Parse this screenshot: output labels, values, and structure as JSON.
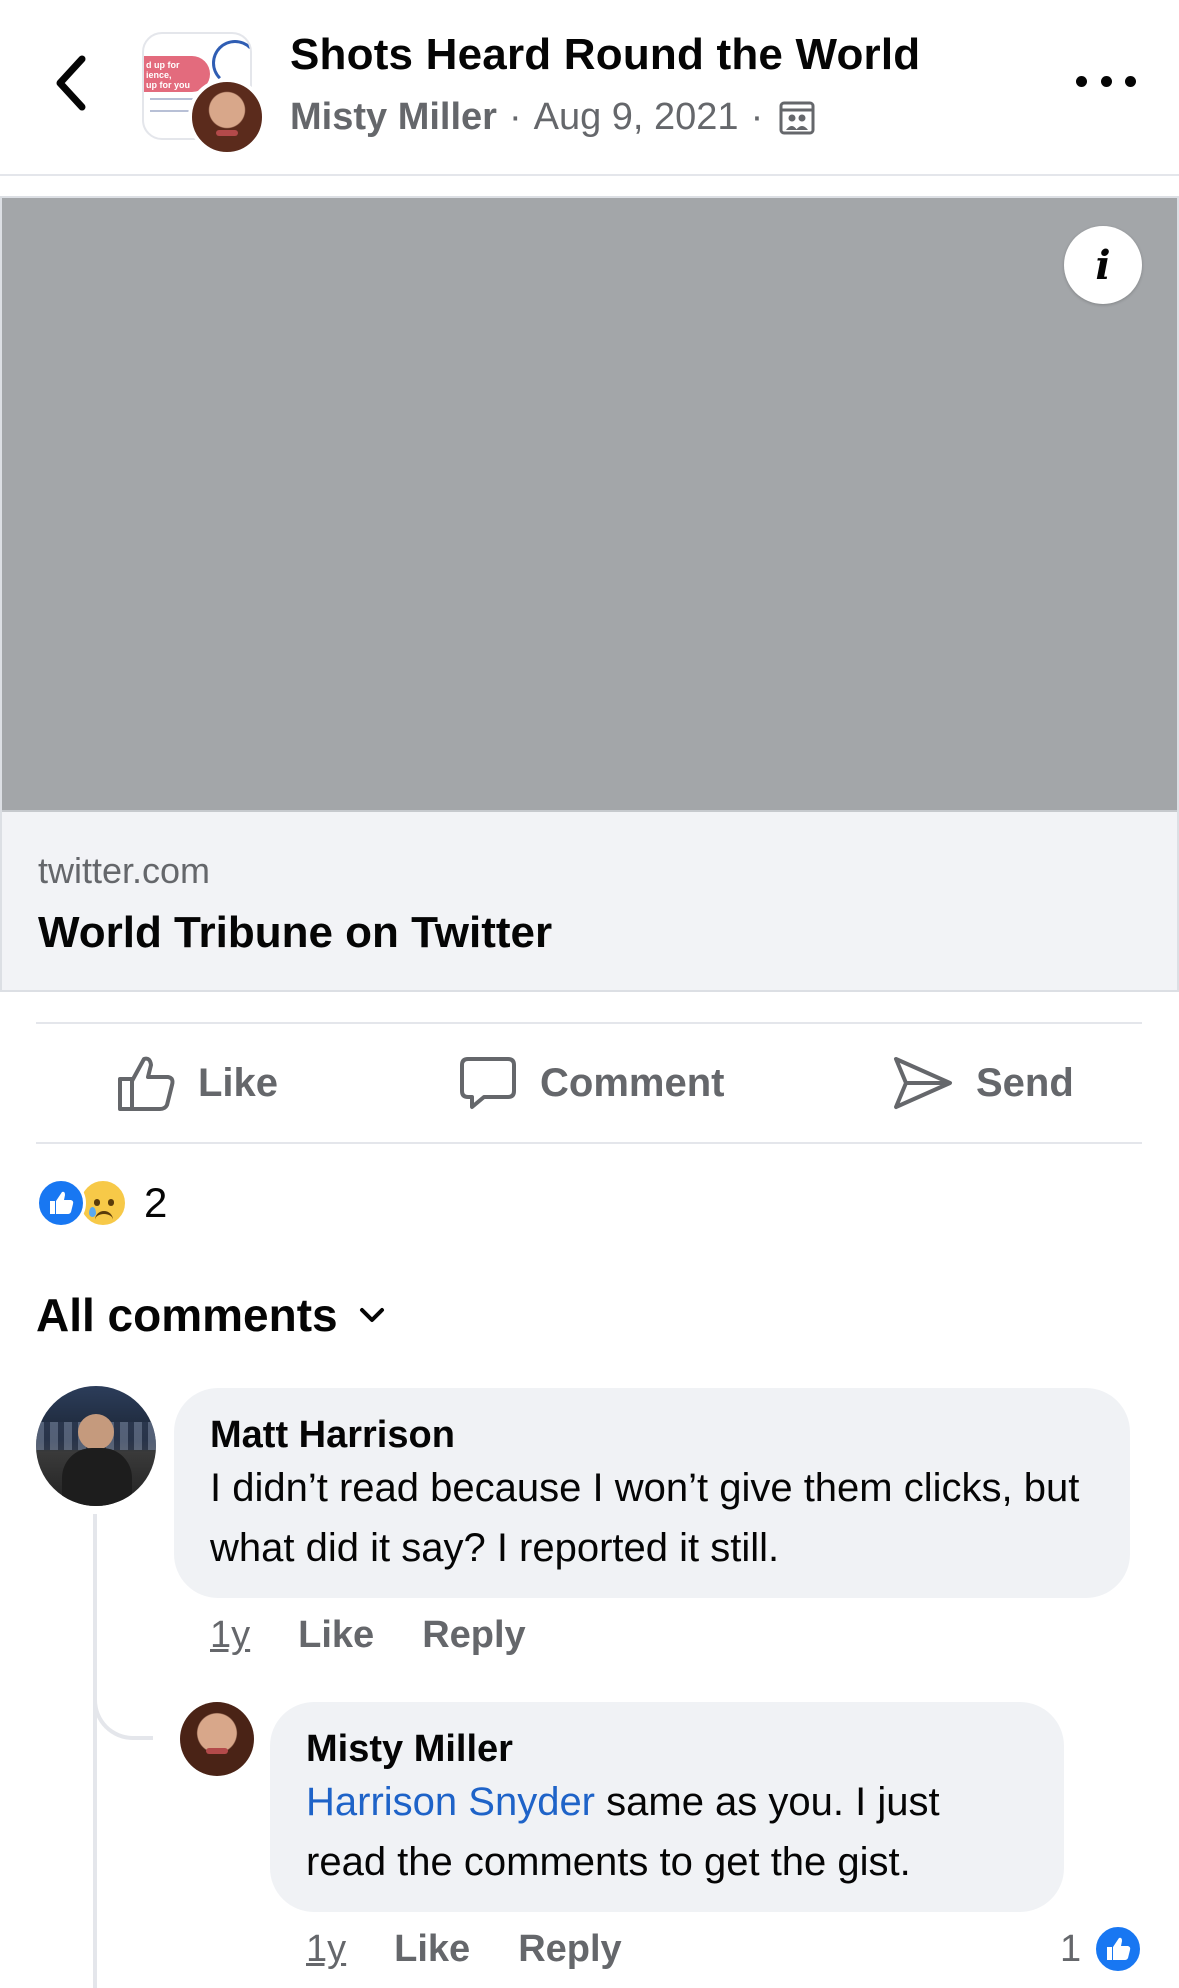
{
  "header": {
    "title": "Shots Heard Round the World",
    "author": "Misty Miller",
    "separator": "·",
    "date": "Aug 9, 2021",
    "thumb_text": "d up for\nience,\nup for you"
  },
  "post": {
    "link_domain": "twitter.com",
    "link_title": "World Tribune on Twitter",
    "info_label": "i"
  },
  "actions": {
    "like": "Like",
    "comment": "Comment",
    "send": "Send"
  },
  "reactions": {
    "types": [
      "like",
      "sad"
    ],
    "count": "2"
  },
  "comments_filter": "All comments",
  "comments": [
    {
      "author": "Matt Harrison",
      "text": "I didn’t read because I won’t give them clicks, but what did it say? I reported it still.",
      "time": "1y",
      "like": "Like",
      "reply": "Reply"
    }
  ],
  "reply": {
    "author": "Misty Miller",
    "mention": "Harrison Snyder",
    "text": " same as you. I just read the comments to get the gist.",
    "time": "1y",
    "like": "Like",
    "reply": "Reply",
    "like_count": "1"
  },
  "colors": {
    "accent": "#1877f2",
    "mention": "#1e63c8",
    "secondary_text": "#65676b",
    "bubble": "#f0f2f5",
    "preview_image": "#a3a6a9"
  }
}
